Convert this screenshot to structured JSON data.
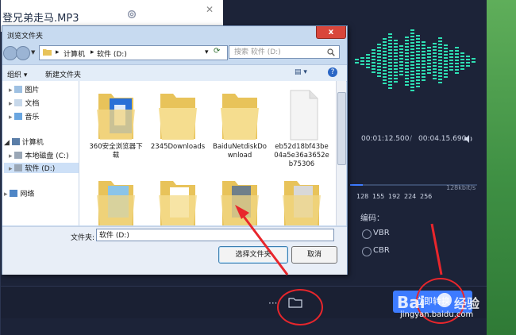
{
  "app": {
    "title": "登兄弟走马.MP3",
    "time_current": "00:01:12.500",
    "time_separator": "/",
    "time_total": "00:04.15.690",
    "bitrate_ticks": [
      "128",
      "155",
      "192",
      "224",
      "256"
    ],
    "bitrate_unit": "128kbit/s",
    "encoding_label": "编码：",
    "encoding_options": [
      "VBR",
      "CBR"
    ],
    "more_label": "···",
    "convert_label": "立即转换",
    "accent_color": "#3d7bff",
    "wave_color": "#2ee0b4"
  },
  "dialog": {
    "title": "浏览文件夹",
    "close_label": "x",
    "address": [
      "计算机",
      "软件 (D:)"
    ],
    "search_placeholder": "搜索 软件 (D:)",
    "organize_label": "组织 ▾",
    "new_folder_label": "新建文件夹",
    "nav": {
      "items": [
        {
          "label": "图片",
          "icon": "pictures-icon"
        },
        {
          "label": "文档",
          "icon": "documents-icon"
        },
        {
          "label": "音乐",
          "icon": "music-icon"
        },
        {
          "label": "计算机",
          "icon": "computer-icon"
        },
        {
          "label": "本地磁盘 (C:)",
          "icon": "drive-icon"
        },
        {
          "label": "软件 (D:)",
          "icon": "drive-icon",
          "selected": true
        },
        {
          "label": "网络",
          "icon": "network-icon"
        }
      ]
    },
    "files": [
      {
        "label": "360安全浏览器下载",
        "icon": "folder-360-icon"
      },
      {
        "label": "2345Downloads",
        "icon": "folder-icon"
      },
      {
        "label": "BaiduNetdiskDownload",
        "icon": "folder-icon"
      },
      {
        "label": "eb52d18bf43be04a5e36a3652eb75306",
        "icon": "blank-folder-icon"
      },
      {
        "label": "",
        "icon": "folder-icon"
      },
      {
        "label": "",
        "icon": "folder-icon"
      },
      {
        "label": "",
        "icon": "folder-icon"
      },
      {
        "label": "",
        "icon": "folder-icon"
      }
    ],
    "folder_label": "文件夹:",
    "folder_value": "软件 (D:)",
    "select_button": "选择文件夹",
    "cancel_button": "取消"
  },
  "watermark": {
    "text": "jingyan.baidu.com"
  }
}
